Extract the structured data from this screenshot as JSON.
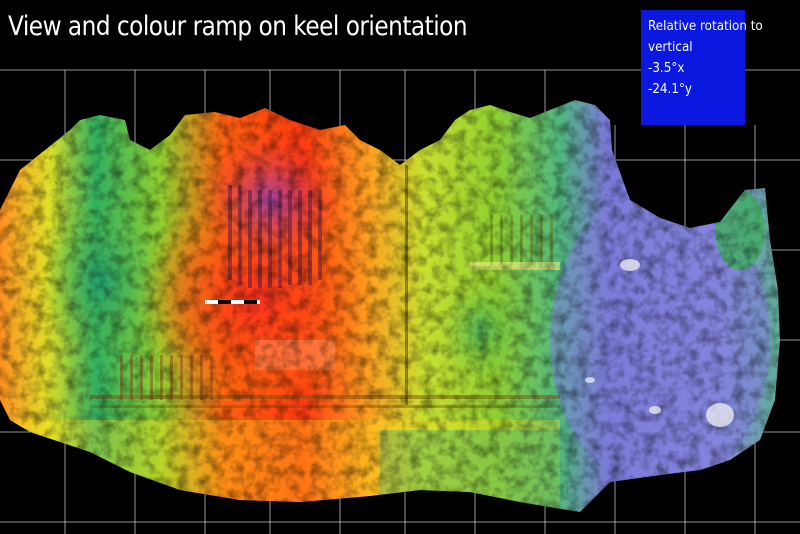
{
  "title": "View and colour ramp on keel orientation",
  "info_box": {
    "heading_line1": "Relative rotation to",
    "heading_line2": "vertical",
    "x_rotation": "-3.5°x",
    "y_rotation": "-24.1°y",
    "background_color": "#0a18e0"
  },
  "colors": {
    "background": "#000000",
    "grid": "#ffffff",
    "ramp": [
      "#ff2a10",
      "#ff7a10",
      "#f5e020",
      "#b8e030",
      "#2bbf5a",
      "#2aa8b0",
      "#8088e0",
      "#c080e0"
    ]
  }
}
